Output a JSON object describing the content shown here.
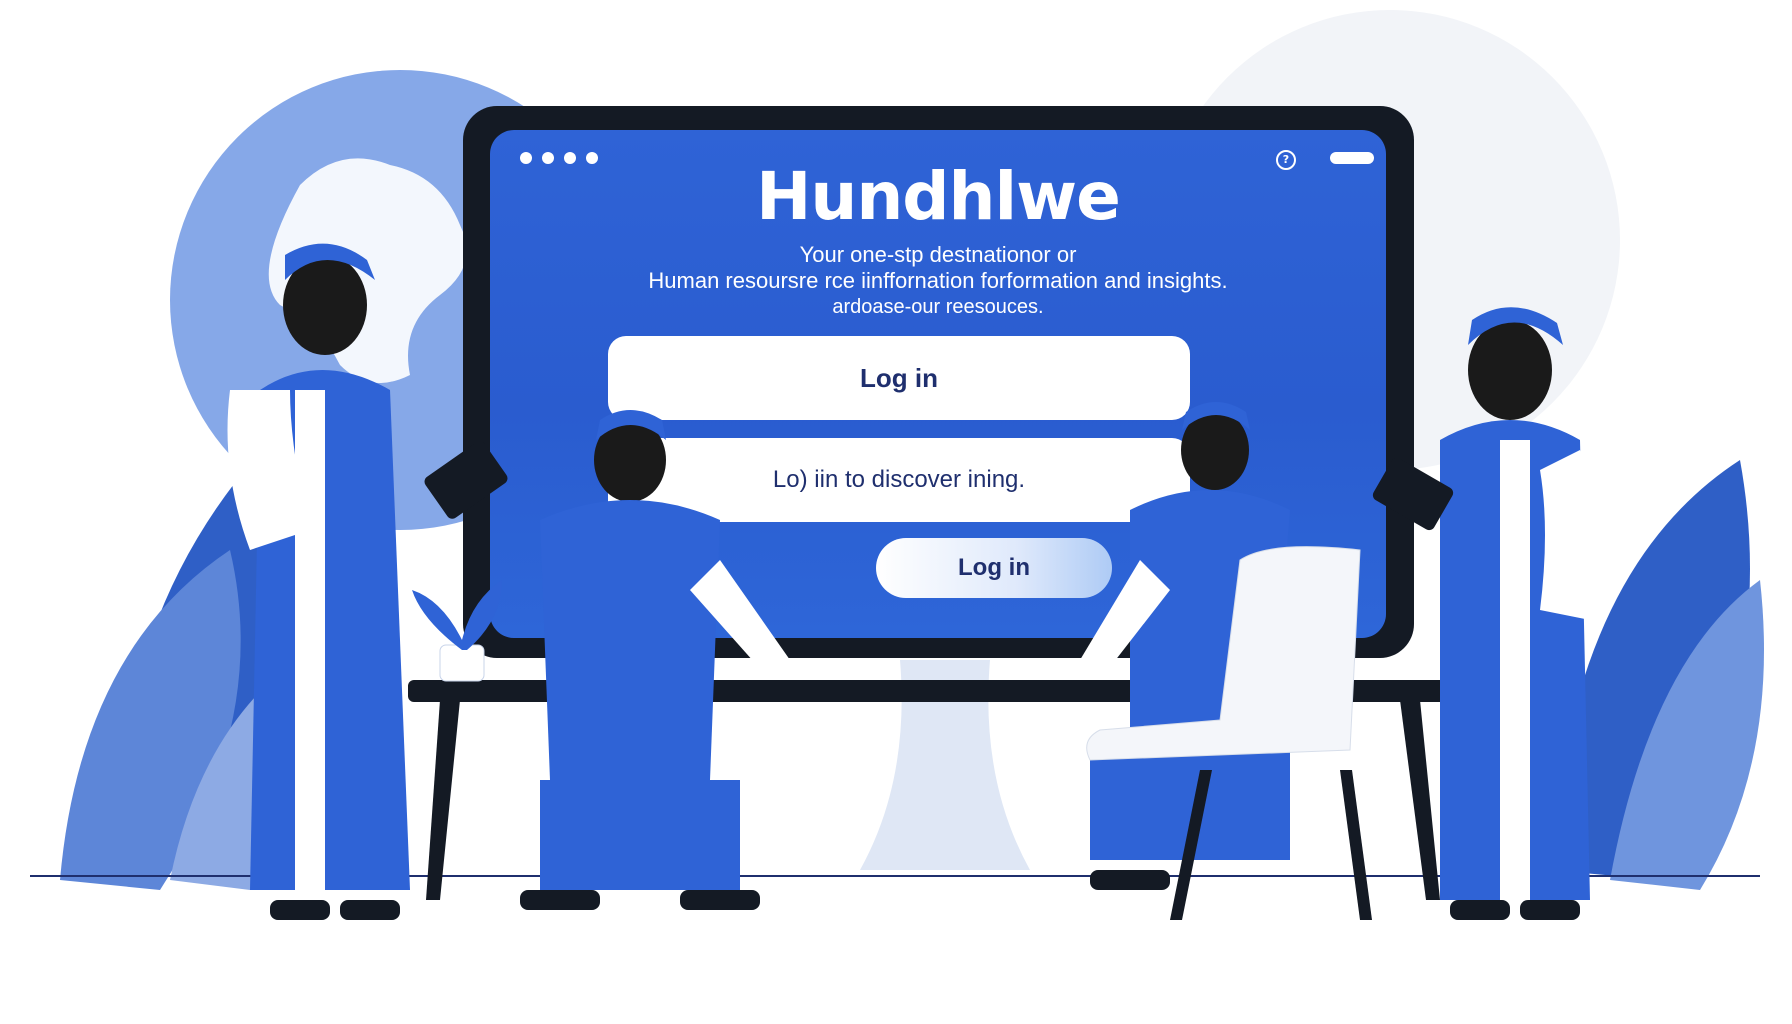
{
  "app": {
    "title": "Hundhlwe",
    "tagline_line1": "Your one-stp destnationor or",
    "tagline_line2": "Human resoursre rce iinffornation forformation  and insights.",
    "tagline_line3": "ardoase-our reesouces."
  },
  "form": {
    "login_field_label": "Log in",
    "discover_field_label": "Lo) iin to discover ining.",
    "login_button_label": "Log in"
  },
  "window": {
    "help_icon": "help-icon",
    "help_glyph": "?"
  },
  "colors": {
    "screen_blue": "#2f63d6",
    "accent_blue": "#2a5fd4",
    "navy": "#1f2f6e",
    "monitor_bezel": "#141a24"
  }
}
